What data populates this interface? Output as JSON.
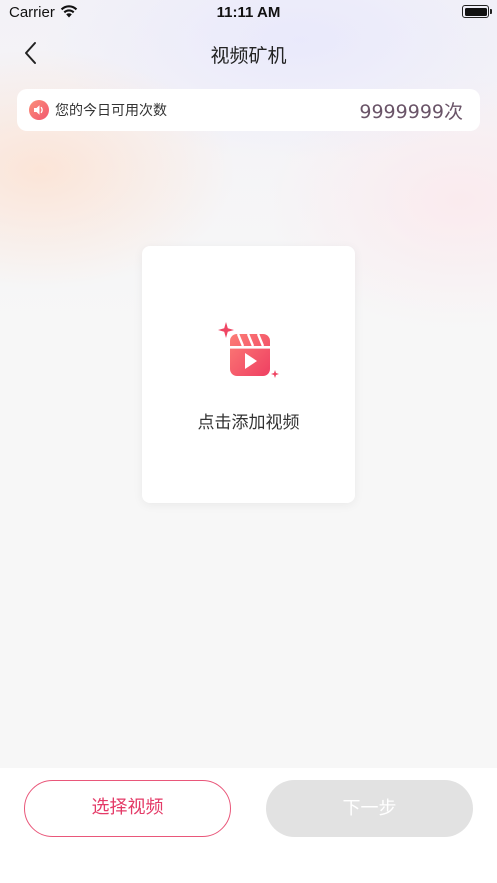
{
  "status_bar": {
    "carrier": "Carrier",
    "time": "11:11 AM"
  },
  "nav": {
    "title": "视频矿机"
  },
  "usage": {
    "label": "您的今日可用次数",
    "value": "9999999次"
  },
  "add_video": {
    "label": "点击添加视频"
  },
  "footer": {
    "select_label": "选择视频",
    "next_label": "下一步"
  },
  "colors": {
    "accent": "#e43a67",
    "disabled": "#e2e2e2"
  }
}
